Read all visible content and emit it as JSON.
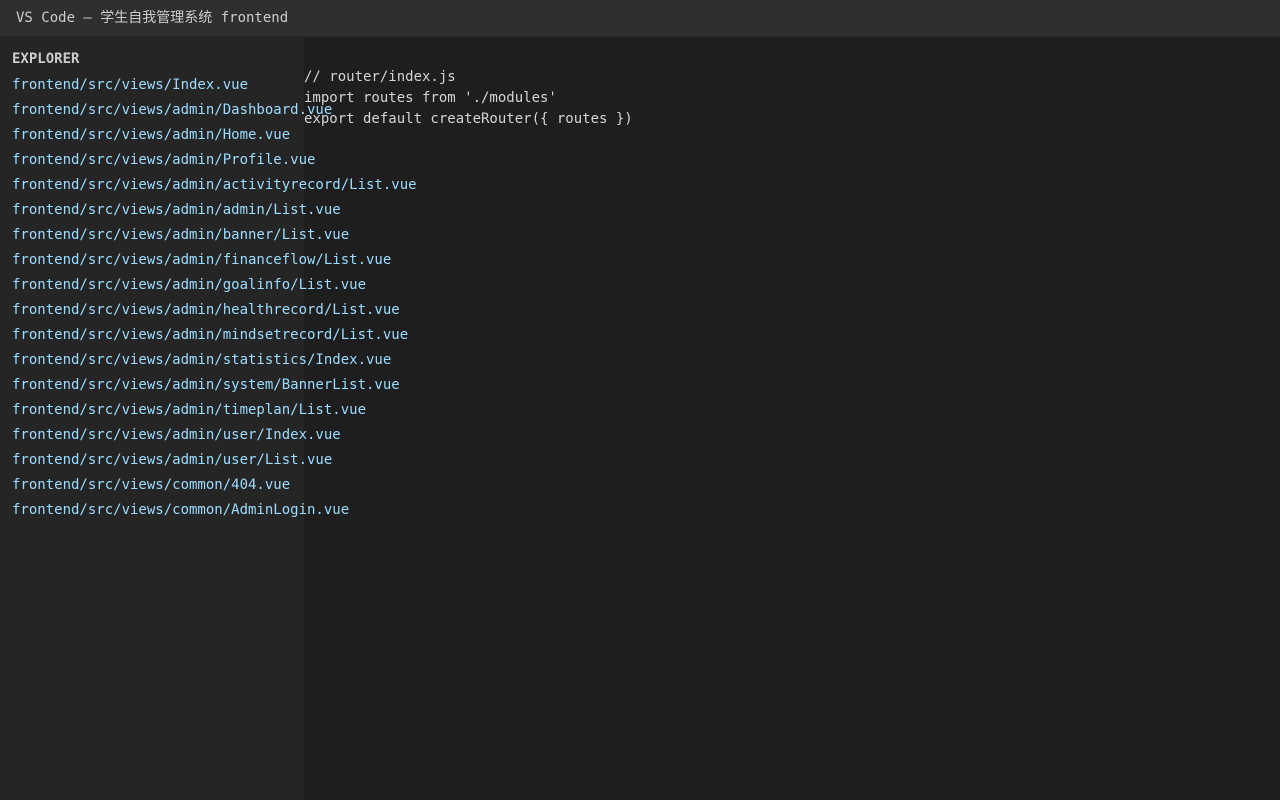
{
  "window": {
    "title": "VS Code — 学生自我管理系统 frontend"
  },
  "explorer": {
    "title": "EXPLORER",
    "files": [
      "frontend/src/views/Index.vue",
      "frontend/src/views/admin/Dashboard.vue",
      "frontend/src/views/admin/Home.vue",
      "frontend/src/views/admin/Profile.vue",
      "frontend/src/views/admin/activityrecord/List.vue",
      "frontend/src/views/admin/admin/List.vue",
      "frontend/src/views/admin/banner/List.vue",
      "frontend/src/views/admin/financeflow/List.vue",
      "frontend/src/views/admin/goalinfo/List.vue",
      "frontend/src/views/admin/healthrecord/List.vue",
      "frontend/src/views/admin/mindsetrecord/List.vue",
      "frontend/src/views/admin/statistics/Index.vue",
      "frontend/src/views/admin/system/BannerList.vue",
      "frontend/src/views/admin/timeplan/List.vue",
      "frontend/src/views/admin/user/Index.vue",
      "frontend/src/views/admin/user/List.vue",
      "frontend/src/views/common/404.vue",
      "frontend/src/views/common/AdminLogin.vue"
    ]
  },
  "editor": {
    "lines": [
      "// router/index.js",
      "import routes from './modules'",
      "export default createRouter({ routes })"
    ]
  },
  "colors": {
    "titlebar": "#2f2f2f",
    "sidebar": "#252526",
    "editor": "#1e1e1e",
    "file_link": "#9cdcfe",
    "text": "#d4d4d4"
  }
}
